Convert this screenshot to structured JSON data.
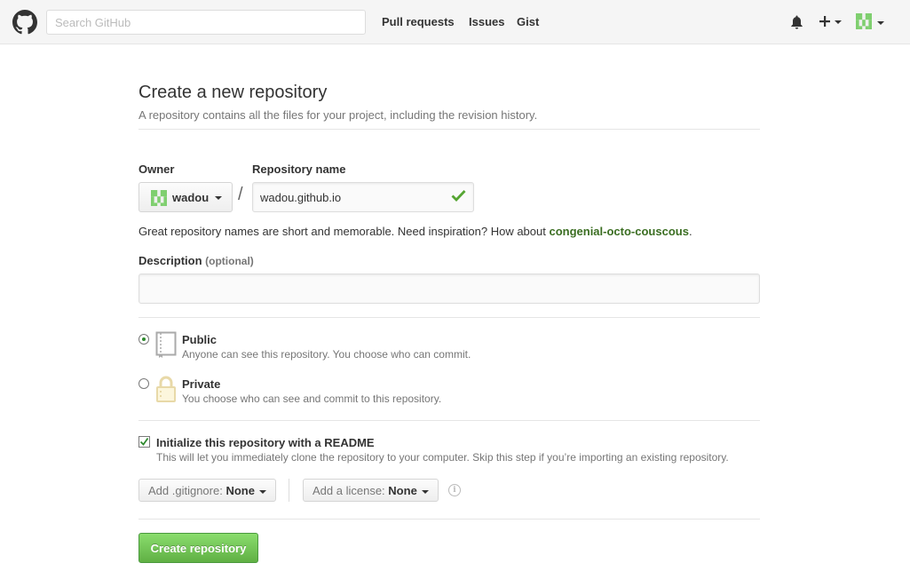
{
  "header": {
    "search_placeholder": "Search GitHub",
    "nav": [
      "Pull requests",
      "Issues",
      "Gist"
    ]
  },
  "page": {
    "title": "Create a new repository",
    "subtitle": "A repository contains all the files for your project, including the revision history."
  },
  "form": {
    "owner_label": "Owner",
    "owner_value": "wadou",
    "repo_label": "Repository name",
    "repo_value": "wadou.github.io",
    "slash": "/",
    "hint_text": "Great repository names are short and memorable. Need inspiration? How about ",
    "hint_suggestion": "congenial-octo-couscous",
    "hint_end": ".",
    "description_label": "Description",
    "description_optional": "(optional)",
    "description_value": ""
  },
  "visibility": {
    "public_title": "Public",
    "public_note": "Anyone can see this repository. You choose who can commit.",
    "private_title": "Private",
    "private_note": "You choose who can see and commit to this repository.",
    "selected": "Public"
  },
  "init": {
    "checked": true,
    "title": "Initialize this repository with a README",
    "note": "This will let you immediately clone the repository to your computer. Skip this step if you’re importing an existing repository."
  },
  "options": {
    "gitignore_label": "Add .gitignore:",
    "gitignore_value": "None",
    "license_label": "Add a license:",
    "license_value": "None",
    "info_glyph": "i"
  },
  "submit_label": "Create repository",
  "colors": {
    "accent_green": "#60b044",
    "suggestion_green": "#3b6e22",
    "identicon_green": "#7fcf6f"
  }
}
